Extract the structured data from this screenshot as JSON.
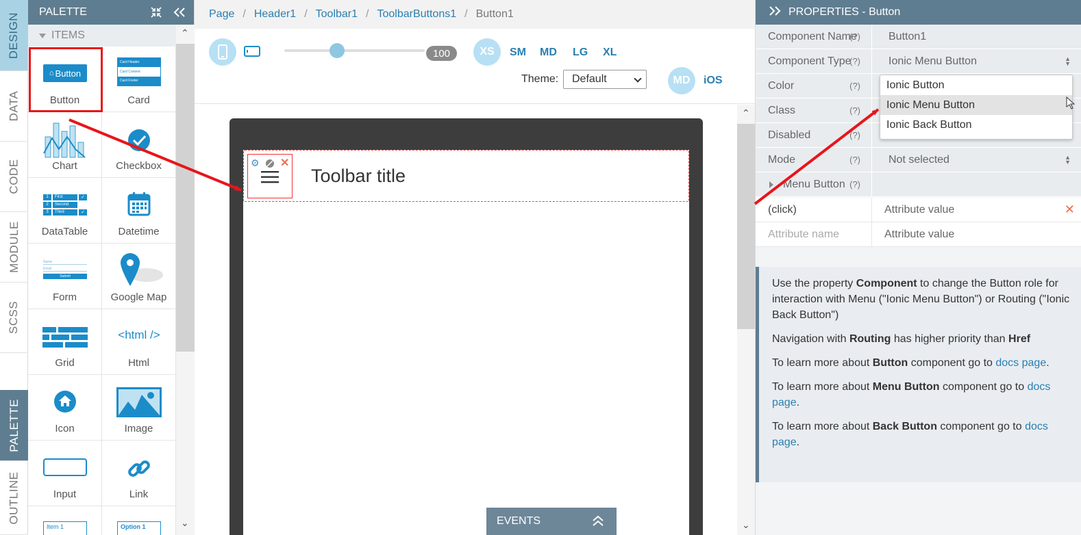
{
  "vtabs": [
    "DESIGN",
    "DATA",
    "CODE",
    "MODULE",
    "SCSS",
    "PALETTE",
    "OUTLINE"
  ],
  "palette": {
    "title": "PALETTE",
    "section": "ITEMS",
    "items": [
      {
        "label": "Button",
        "icon": "button-icon"
      },
      {
        "label": "Card",
        "icon": "card-icon"
      },
      {
        "label": "Chart",
        "icon": "chart-icon"
      },
      {
        "label": "Checkbox",
        "icon": "checkbox-icon"
      },
      {
        "label": "DataTable",
        "icon": "datatable-icon"
      },
      {
        "label": "Datetime",
        "icon": "calendar-icon"
      },
      {
        "label": "Form",
        "icon": "form-icon"
      },
      {
        "label": "Google Map",
        "icon": "map-pin-icon"
      },
      {
        "label": "Grid",
        "icon": "grid-icon"
      },
      {
        "label": "Html",
        "icon": "html-icon"
      },
      {
        "label": "Icon",
        "icon": "home-icon"
      },
      {
        "label": "Image",
        "icon": "image-icon"
      },
      {
        "label": "Input",
        "icon": "input-icon"
      },
      {
        "label": "Link",
        "icon": "link-icon"
      }
    ],
    "button_icon_text": "Button",
    "html_icon_text": "<html />",
    "card_lines": [
      "Card Header",
      "Card Content",
      "Card Footer"
    ],
    "table_rows": [
      [
        "1",
        "First"
      ],
      [
        "2",
        "Second"
      ],
      [
        "3",
        "Third"
      ]
    ],
    "form_lines": [
      "Name",
      "Email",
      "Submit"
    ],
    "partial_items": [
      "Item 1",
      "Option 1"
    ]
  },
  "breadcrumb": [
    "Page",
    "Header1",
    "Toolbar1",
    "ToolbarButtons1",
    "Button1"
  ],
  "toolbar": {
    "zoom": "100",
    "breakpoints": [
      "XS",
      "SM",
      "MD",
      "LG",
      "XL"
    ],
    "theme_label": "Theme:",
    "theme_value": "Default",
    "modes": [
      "MD",
      "iOS"
    ]
  },
  "canvas": {
    "toolbar_title": "Toolbar title",
    "events_label": "EVENTS"
  },
  "properties": {
    "title": "PROPERTIES - Button",
    "help_marker": "(?)",
    "rows": [
      {
        "name": "Component Name",
        "value": "Button1"
      },
      {
        "name": "Component Type",
        "value": "Ionic Menu Button"
      },
      {
        "name": "Color",
        "value": ""
      },
      {
        "name": "Class",
        "value": ""
      },
      {
        "name": "Disabled",
        "value": ""
      },
      {
        "name": "Mode",
        "value": "Not selected"
      },
      {
        "name": "Menu Button",
        "value": ""
      }
    ],
    "attr_rows": [
      {
        "name": "(click)",
        "value_placeholder": "Attribute value"
      },
      {
        "name_placeholder": "Attribute name",
        "value_placeholder": "Attribute value"
      }
    ],
    "dropdown_options": [
      "Ionic Button",
      "Ionic Menu Button",
      "Ionic Back Button"
    ],
    "dropdown_selected": "Ionic Menu Button"
  },
  "help": {
    "p1_a": "Use the property ",
    "p1_b": "Component",
    "p1_c": " to change the Button role for interaction with Menu (\"Ionic Menu Button\") or Routing (\"Ionic Back Button\")",
    "p2_a": "Navigation with ",
    "p2_b": "Routing",
    "p2_c": " has higher priority than ",
    "p2_d": "Href",
    "p3_a": "To learn more about ",
    "p3_b": "Button",
    "p3_c": " component go to ",
    "p4_b": "Menu Button",
    "p5_b": "Back Button",
    "link": "docs page",
    "period": "."
  },
  "colors": {
    "accent": "#2a7fb0",
    "header_bg": "#5f7d90",
    "annotation": "#e8151b",
    "breakpoint_circle": "#b7e0f4"
  }
}
